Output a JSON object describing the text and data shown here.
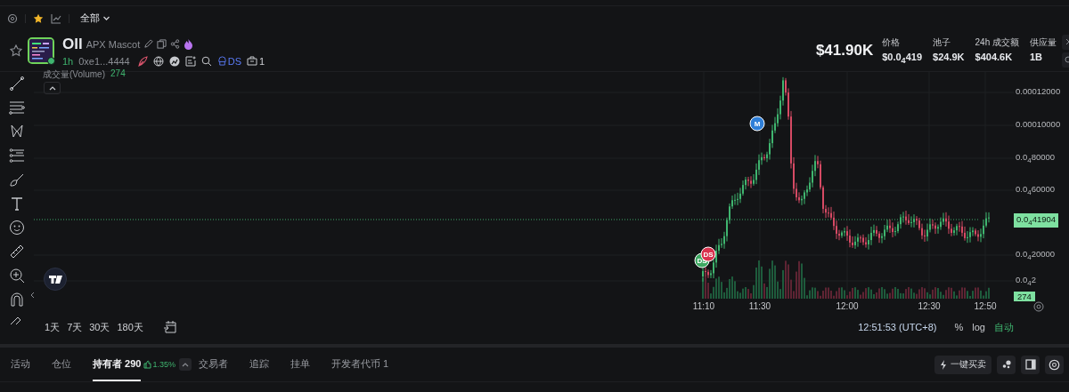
{
  "topbar": {
    "filter": "全部"
  },
  "token": {
    "symbol": "Oll",
    "name": "APX Mascot",
    "age": "1h",
    "address": "0xe1...4444",
    "ds_label": "DS",
    "holder_count": "1"
  },
  "stats": {
    "market_cap": "$41.90K",
    "items": [
      {
        "label": "价格",
        "value": "$0.0$_{4}$419"
      },
      {
        "label": "池子",
        "value": "$24.9K"
      },
      {
        "label": "24h 成交额",
        "value": "$404.6K"
      },
      {
        "label": "供应量",
        "value": "1B"
      }
    ]
  },
  "chart": {
    "volume_label": "成交量(Volume)",
    "volume_value": "274",
    "y_ticks": [
      "0.00012000",
      "0.00010000",
      "0.0$_{4}$80000",
      "0.0$_{4}$60000",
      "0.0$_{4}$20000",
      "0.0$_{4}$2"
    ],
    "last_price": "0.0$_{4}$41904",
    "last_volume": "274",
    "x_ticks": [
      "11:10",
      "11:30",
      "12:00",
      "12:30",
      "12:50"
    ],
    "markers": [
      {
        "label": "DS",
        "color": "#3ea862"
      },
      {
        "label": "DS",
        "color": "#d9344f"
      },
      {
        "label": "M",
        "color": "#2f7fd8"
      }
    ]
  },
  "ranges": [
    "1天",
    "7天",
    "30天",
    "180天"
  ],
  "clock": "12:51:53 (UTC+8)",
  "scale_buttons": [
    {
      "label": "%",
      "selected": false
    },
    {
      "label": "log",
      "selected": false
    },
    {
      "label": "自动",
      "selected": true
    }
  ],
  "tabs": [
    {
      "label": "活动",
      "selected": false
    },
    {
      "label": "仓位",
      "selected": false
    },
    {
      "label": "持有者 290",
      "selected": true,
      "badge": "1.35%"
    },
    {
      "label": "交易者",
      "selected": false
    },
    {
      "label": "追踪",
      "selected": false
    },
    {
      "label": "挂单",
      "selected": false
    },
    {
      "label": "开发者代币 1",
      "selected": false
    }
  ],
  "quick_trade": "一键买卖"
}
